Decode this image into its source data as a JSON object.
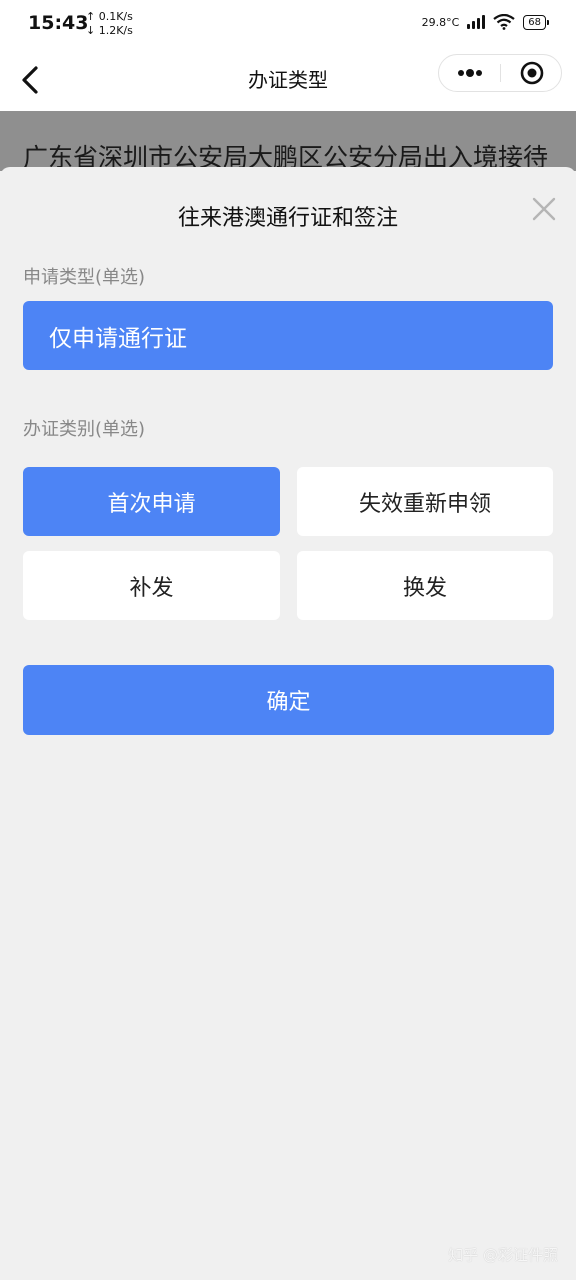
{
  "status_bar": {
    "time": "15:43",
    "upload_speed": "↑ 0.1K/s",
    "download_speed": "↓ 1.2K/s",
    "temperature": "29.8°C",
    "battery": "68"
  },
  "nav": {
    "title": "办证类型",
    "back_icon": "chevron-left-icon",
    "more_icon": "more-dots-icon",
    "close_icon": "target-circle-icon"
  },
  "background_header": {
    "text": "广东省深圳市公安局大鹏区公安分局出入境接待"
  },
  "sheet": {
    "title": "往来港澳通行证和签注",
    "close_icon": "close-icon",
    "application_type": {
      "label": "申请类型(单选)",
      "options": [
        {
          "label": "仅申请通行证",
          "selected": true
        }
      ]
    },
    "certificate_category": {
      "label": "办证类别(单选)",
      "options": [
        {
          "label": "首次申请",
          "selected": true
        },
        {
          "label": "失效重新申领",
          "selected": false
        },
        {
          "label": "补发",
          "selected": false
        },
        {
          "label": "换发",
          "selected": false
        }
      ]
    },
    "confirm_label": "确定"
  },
  "watermark": "知乎 @彩证件照",
  "colors": {
    "accent": "#4d84f5",
    "page_background": "#f0f0f0",
    "overlay": "#8f8f8f"
  }
}
